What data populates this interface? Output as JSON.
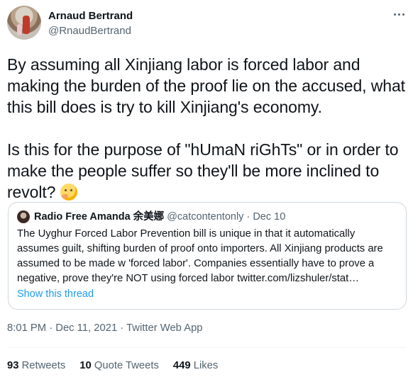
{
  "author": {
    "name": "Arnaud Bertrand",
    "handle": "@RnaudBertrand"
  },
  "tweet": {
    "paragraph1": "By assuming all Xinjiang labor is forced labor and making the burden of the proof lie on the accused, what this bill does is try to kill Xinjiang's economy.",
    "paragraph2": "Is this for the purpose of \"hUmaN riGhTs\" or in order to make the people suffer so they'll be more inclined to revolt?",
    "emoji": "thinking-face-icon"
  },
  "quoted": {
    "name": "Radio Free Amanda 余美娜",
    "handle": "@catcontentonly",
    "separator": " · ",
    "date": "Dec 10",
    "text": "The Uyghur Forced Labor Prevention bill is unique in that  it automatically assumes guilt, shifting burden of proof onto importers. All Xinjiang products are assumed to be made w 'forced labor'. Companies essentially have to prove a negative, prove they're NOT using forced labor twitter.com/lizshuler/stat…",
    "show_thread": "Show this thread"
  },
  "timestamp": "8:01 PM · Dec 11, 2021 · Twitter Web App",
  "stats": {
    "retweets_count": "93",
    "retweets_label": "Retweets",
    "quotes_count": "10",
    "quotes_label": "Quote Tweets",
    "likes_count": "449",
    "likes_label": "Likes"
  },
  "colors": {
    "text": "#0f1419",
    "secondary": "#536471",
    "link": "#1d9bf0",
    "border": "#cfd9de"
  }
}
